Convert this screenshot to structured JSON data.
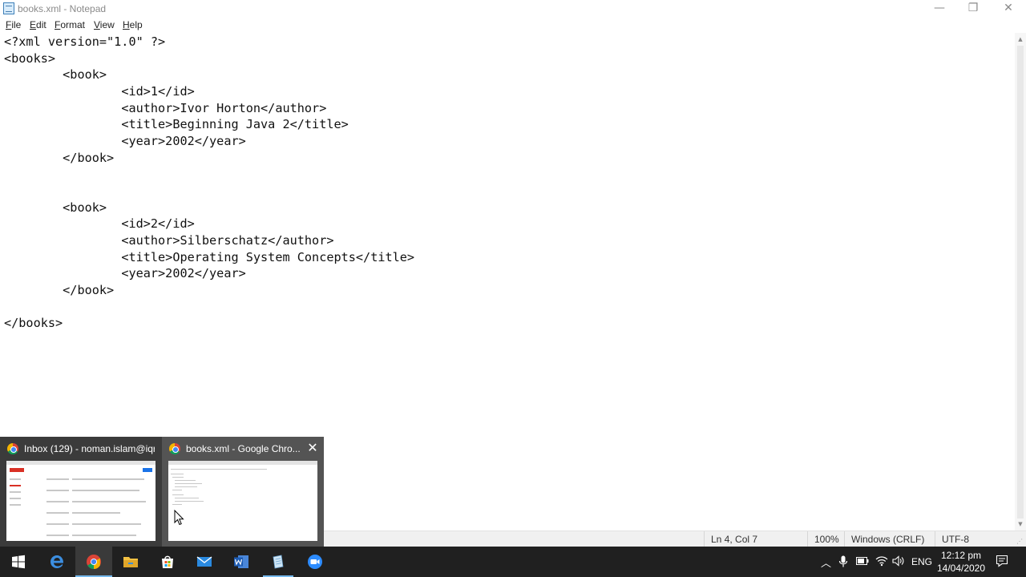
{
  "window": {
    "title": "books.xml - Notepad",
    "minimize_glyph": "—",
    "maximize_glyph": "❐",
    "close_glyph": "✕"
  },
  "menu": {
    "items": [
      {
        "key": "F",
        "rest": "ile"
      },
      {
        "key": "E",
        "rest": "dit"
      },
      {
        "key": "F",
        "rest": "ormat",
        "first": ""
      },
      {
        "key": "V",
        "rest": "iew"
      },
      {
        "key": "H",
        "rest": "elp"
      }
    ]
  },
  "editor": {
    "content": "<?xml version=\"1.0\" ?>\n<books>\n\t<book>\n\t\t<id>1</id>\n\t\t<author>Ivor Horton</author>\n\t\t<title>Beginning Java 2</title>\n\t\t<year>2002</year>\n\t</book>\n\n\n\t<book>\n\t\t<id>2</id>\n\t\t<author>Silberschatz</author>\n\t\t<title>Operating System Concepts</title>\n\t\t<year>2002</year>\n\t</book>\n\n</books>"
  },
  "status": {
    "position": "Ln 4, Col 7",
    "zoom": "100%",
    "line_endings": "Windows (CRLF)",
    "encoding": "UTF-8"
  },
  "taskbar_preview": {
    "items": [
      {
        "label": "Inbox (129) - noman.islam@iqr...",
        "icon": "chrome-icon"
      },
      {
        "label": "books.xml - Google Chro...",
        "icon": "chrome-icon",
        "close_glyph": "✕"
      }
    ]
  },
  "taskbar": {
    "apps": [
      "windows-start-icon",
      "edge-icon",
      "chrome-icon",
      "file-explorer-icon",
      "store-icon",
      "mail-icon",
      "word-icon",
      "notepad-icon",
      "zoom-icon"
    ],
    "tray": {
      "language": "ENG",
      "time": "12:12 pm",
      "date": "14/04/2020"
    },
    "accent_color": "#76b9ed"
  }
}
